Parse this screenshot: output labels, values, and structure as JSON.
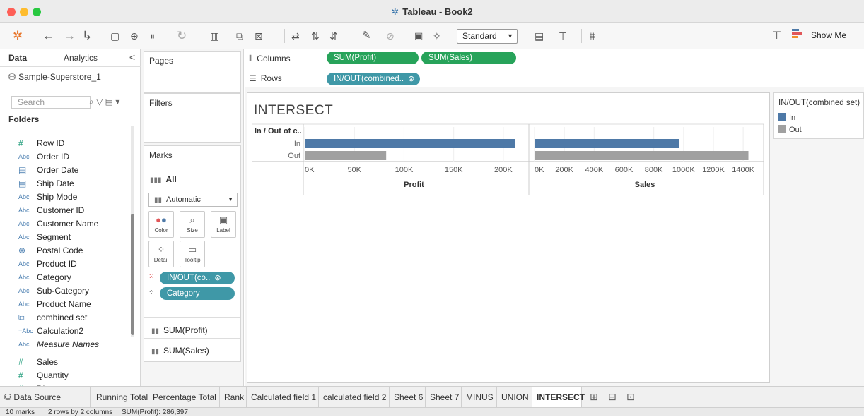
{
  "window": {
    "title": "Tableau - Book2"
  },
  "toolbar": {
    "icons": [
      "tableau-logo-icon",
      "back-icon",
      "forward-icon",
      "redo-icon",
      "save-icon",
      "new-datasource-icon",
      "pause-icon",
      "refresh-icon",
      "new-worksheet-icon",
      "duplicate-icon",
      "clear-icon",
      "swap-icon",
      "sort-asc-icon",
      "sort-desc-icon",
      "highlight-icon",
      "group-icon",
      "label-icon",
      "pin-icon",
      "fit-icon",
      "presentation-icon",
      "share-icon"
    ],
    "fit_select": "Standard",
    "show_me": "Show Me"
  },
  "data_pane": {
    "tab_data": "Data",
    "tab_analytics": "Analytics",
    "collapse": "<",
    "datasource": "Sample-Superstore_1",
    "search_placeholder": "Search",
    "folders": "Folders",
    "fields": [
      {
        "type": "#",
        "name": "Row ID",
        "kind": "measure"
      },
      {
        "type": "Abc",
        "name": "Order ID",
        "kind": "dim"
      },
      {
        "type": "▤",
        "name": "Order Date",
        "kind": "date"
      },
      {
        "type": "▤",
        "name": "Ship Date",
        "kind": "date"
      },
      {
        "type": "Abc",
        "name": "Ship Mode",
        "kind": "dim"
      },
      {
        "type": "Abc",
        "name": "Customer ID",
        "kind": "dim"
      },
      {
        "type": "Abc",
        "name": "Customer Name",
        "kind": "dim"
      },
      {
        "type": "Abc",
        "name": "Segment",
        "kind": "dim"
      },
      {
        "type": "⊕",
        "name": "Postal Code",
        "kind": "geo"
      },
      {
        "type": "Abc",
        "name": "Product ID",
        "kind": "dim"
      },
      {
        "type": "Abc",
        "name": "Category",
        "kind": "dim"
      },
      {
        "type": "Abc",
        "name": "Sub-Category",
        "kind": "dim"
      },
      {
        "type": "Abc",
        "name": "Product Name",
        "kind": "dim"
      },
      {
        "type": "⧉",
        "name": "combined set",
        "kind": "set"
      },
      {
        "type": "=Abc",
        "name": "Calculation2",
        "kind": "calc"
      },
      {
        "type": "Abc",
        "name": "Measure Names",
        "kind": "dim",
        "italic": true
      },
      {
        "type": "#",
        "name": "Sales",
        "kind": "measure"
      },
      {
        "type": "#",
        "name": "Quantity",
        "kind": "measure"
      },
      {
        "type": "#",
        "name": "Discount",
        "kind": "measure"
      }
    ]
  },
  "shelves": {
    "pages": "Pages",
    "filters": "Filters",
    "marks": "Marks",
    "marks_all": "All",
    "mark_type": "Automatic",
    "mark_buttons": [
      {
        "label": "Color",
        "icon": "color-icon"
      },
      {
        "label": "Size",
        "icon": "size-icon"
      },
      {
        "label": "Label",
        "icon": "label-icon"
      },
      {
        "label": "Detail",
        "icon": "detail-icon"
      },
      {
        "label": "Tooltip",
        "icon": "tooltip-icon"
      }
    ],
    "mark_pills": [
      "IN/OUT(co..",
      "Category"
    ],
    "measure_rows": [
      "SUM(Profit)",
      "SUM(Sales)"
    ],
    "columns_label": "Columns",
    "rows_label": "Rows",
    "columns_pills": [
      "SUM(Profit)",
      "SUM(Sales)"
    ],
    "rows_pill": "IN/OUT(combined.."
  },
  "view": {
    "title": "INTERSECT",
    "row_header": "In / Out of c.."
  },
  "legend": {
    "title": "IN/OUT(combined set)",
    "items": [
      {
        "label": "In",
        "color": "#4e79a7"
      },
      {
        "label": "Out",
        "color": "#a0a0a0"
      }
    ]
  },
  "chart_data": {
    "type": "bar",
    "orientation": "horizontal",
    "categories": [
      "In",
      "Out"
    ],
    "panels": [
      {
        "xlabel": "Profit",
        "xlim": [
          0,
          220000
        ],
        "ticks": [
          "0K",
          "50K",
          "100K",
          "150K",
          "200K"
        ],
        "series": [
          {
            "values": [
              212000,
              82000
            ]
          }
        ]
      },
      {
        "xlabel": "Sales",
        "xlim": [
          0,
          1480000
        ],
        "ticks": [
          "0K",
          "200K",
          "400K",
          "600K",
          "800K",
          "1000K",
          "1200K",
          "1400K"
        ],
        "series": [
          {
            "values": [
              970000,
              1435000
            ]
          }
        ]
      }
    ],
    "colors": {
      "In": "#4e79a7",
      "Out": "#a0a0a0"
    }
  },
  "sheet_tabs": {
    "datasource": "Data Source",
    "tabs": [
      "Running Total",
      "Percentage Total",
      "Rank",
      "Calculated field 1",
      "calculated field 2",
      "Sheet 6",
      "Sheet 7",
      "MINUS",
      "UNION",
      "INTERSECT"
    ],
    "active": "INTERSECT"
  },
  "status": {
    "marks": "10 marks",
    "rows_cols": "2 rows by 2 columns",
    "sum": "SUM(Profit): 286,397"
  }
}
